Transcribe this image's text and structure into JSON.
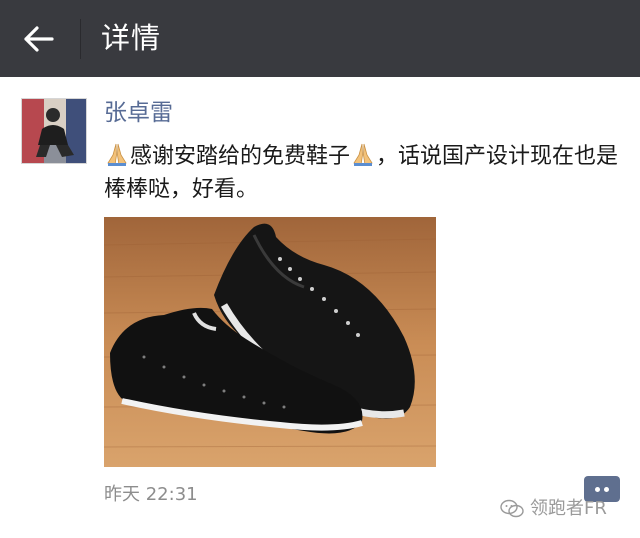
{
  "header": {
    "title": "详情",
    "bg_color": "#393a3f",
    "back_icon": "arrow-left-icon"
  },
  "moment": {
    "author": "张卓雷",
    "text_emoji": "pray-emoji",
    "text_part1": "感谢安踏给的免费鞋子",
    "text_part2": "，话说国产设计现在也是棒棒哒，好看。",
    "photo": "black-sneakers-photo",
    "timestamp": "昨天 22:31",
    "name_color": "#576b95"
  },
  "watermark": {
    "text": "领跑者FR",
    "icon": "wechat-icon"
  }
}
